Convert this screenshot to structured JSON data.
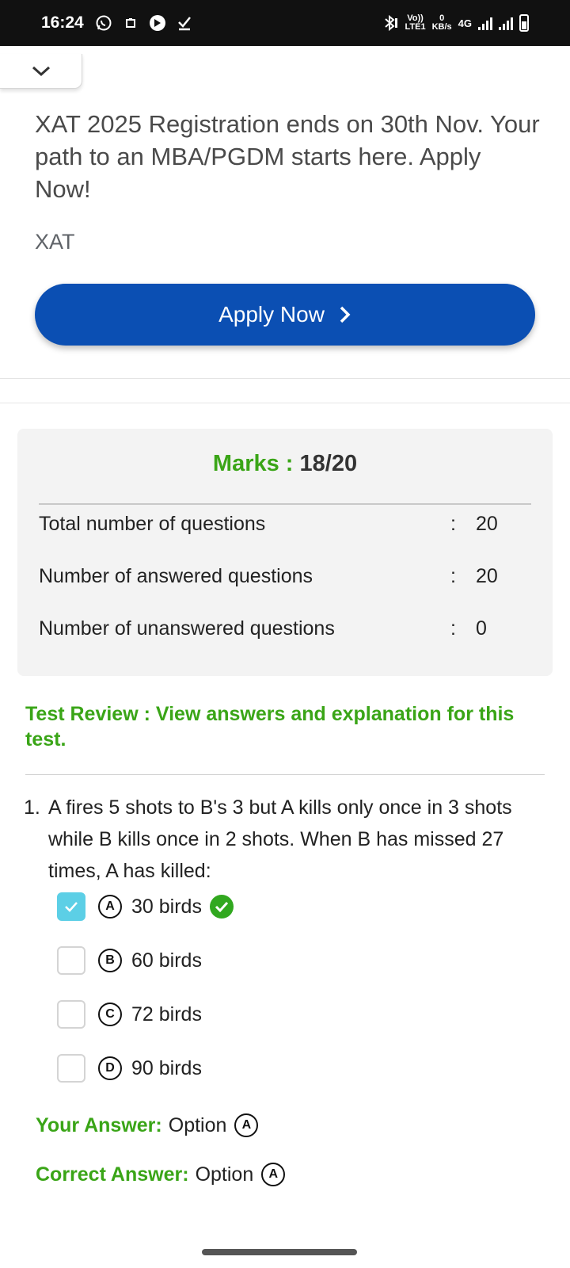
{
  "status_bar": {
    "time": "16:24",
    "network_label": "4G",
    "speed_value": "0",
    "speed_unit": "KB/s",
    "volte_label": "Vo))",
    "lte_label": "LTE1",
    "icons": [
      "whatsapp-icon",
      "notification-icon",
      "app-icon",
      "download-check-icon",
      "bluetooth-icon",
      "signal-icon",
      "signal-icon",
      "battery-icon"
    ]
  },
  "ad": {
    "headline": "XAT 2025 Registration ends on 30th Nov. Your path to an MBA/PGDM starts here. Apply Now!",
    "brand": "XAT",
    "button_label": "Apply Now",
    "button_color": "#0b4fb3"
  },
  "summary": {
    "marks_label": "Marks :",
    "marks_value": "18/20",
    "rows": [
      {
        "label": "Total number of questions",
        "sep": ":",
        "value": "20"
      },
      {
        "label": "Number of answered questions",
        "sep": ":",
        "value": "20"
      },
      {
        "label": "Number of unanswered questions",
        "sep": ":",
        "value": "0"
      }
    ]
  },
  "review_link": "Test Review : View answers and explanation for this test.",
  "question": {
    "number": "1.",
    "text": "A fires 5 shots to B's 3 but A kills only once in 3 shots while B kills once in 2 shots. When B has missed 27 times, A has killed:",
    "options": [
      {
        "letter": "A",
        "text": "30 birds",
        "checked": true,
        "correct": true
      },
      {
        "letter": "B",
        "text": "60 birds",
        "checked": false,
        "correct": false
      },
      {
        "letter": "C",
        "text": "72 birds",
        "checked": false,
        "correct": false
      },
      {
        "letter": "D",
        "text": "90 birds",
        "checked": false,
        "correct": false
      }
    ],
    "your_answer_label": "Your Answer:",
    "your_answer_text": "Option",
    "your_answer_letter": "A",
    "correct_answer_label": "Correct Answer:",
    "correct_answer_text": "Option",
    "correct_answer_letter": "A"
  },
  "colors": {
    "accent_green": "#3aa517",
    "checked_blue": "#5ccfe6",
    "correct_badge": "#31a81f"
  }
}
